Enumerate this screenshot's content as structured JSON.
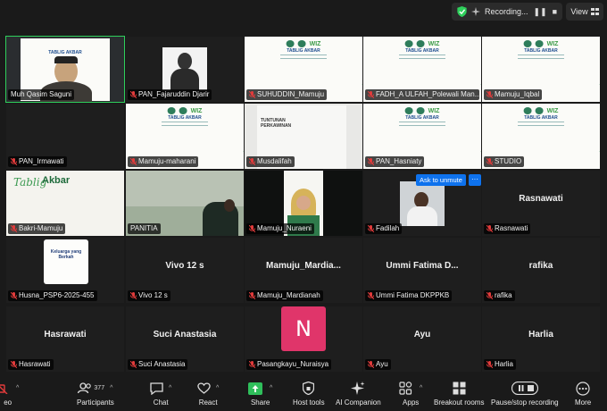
{
  "topbar": {
    "recording_label": "Recording...",
    "view_label": "View"
  },
  "ask_to_unmute": "Ask to unmute",
  "more_dots": "···",
  "participants": [
    {
      "name": "Muh Qasim Saguni"
    },
    {
      "name": "PAN_Fajaruddin Djarir"
    },
    {
      "name": "SUHUDDIN_Mamuju"
    },
    {
      "name": "FADH_A ULFAH_Polewali Man..."
    },
    {
      "name": "Mamuju_Iqbal"
    },
    {
      "name": "PAN_Irmawati"
    },
    {
      "name": "Mamuju-maharani"
    },
    {
      "name": "Musdalifah"
    },
    {
      "name": "PAN_Hasniaty"
    },
    {
      "name": "STUDIO"
    },
    {
      "name": "Bakri-Mamuju"
    },
    {
      "name": "PANITIA"
    },
    {
      "name": "Mamuju_Nuraeni"
    },
    {
      "name": "Fadilah"
    },
    {
      "name": "Rasnawati",
      "display": "Rasnawati"
    },
    {
      "name": "Husna_PSP6-2025-455"
    },
    {
      "name": "Vivo 12 s",
      "display": "Vivo 12 s"
    },
    {
      "name": "Mamuju_Mardianah",
      "display": "Mamuju_Mardia..."
    },
    {
      "name": "Ummi Fatima DKPPKB",
      "display": "Ummi Fatima D..."
    },
    {
      "name": "rafika",
      "display": "rafika"
    },
    {
      "name": "Hasrawati",
      "display": "Hasrawati"
    },
    {
      "name": "Suci Anastasia",
      "display": "Suci Anastasia"
    },
    {
      "name": "Pasangkayu_Nuraisya",
      "avatar_letter": "N"
    },
    {
      "name": "Ayu",
      "display": "Ayu"
    },
    {
      "name": "Harlia",
      "display": "Harlia"
    }
  ],
  "slides": {
    "banner_title": "TABLIG AKBAR",
    "tabligh_script": "Tablig",
    "tabligh_bold": "Akbar",
    "doc_heading": "TUNTUNAN PERKAWINAN",
    "card_heading": "Keluarga yang Berkah"
  },
  "toolbar": {
    "participants_count": "377",
    "items": [
      {
        "label": "Participants",
        "icon": "participants-icon"
      },
      {
        "label": "Chat",
        "icon": "chat-icon"
      },
      {
        "label": "React",
        "icon": "heart-icon"
      },
      {
        "label": "Share",
        "icon": "share-icon"
      },
      {
        "label": "Host tools",
        "icon": "shield-icon"
      },
      {
        "label": "AI Companion",
        "icon": "sparkle-icon"
      },
      {
        "label": "Apps",
        "icon": "apps-icon"
      },
      {
        "label": "Breakout rooms",
        "icon": "breakout-icon"
      },
      {
        "label": "Pause/stop recording",
        "icon": "pause-stop-icon"
      },
      {
        "label": "More",
        "icon": "more-icon"
      }
    ],
    "video_partial": "eo"
  },
  "colors": {
    "active_speaker": "#2ecf5b",
    "accent_blue": "#0e72ed",
    "muted_red": "#e23b3b",
    "avatar_pink": "#e0356a",
    "share_green": "#2fbf5b"
  }
}
